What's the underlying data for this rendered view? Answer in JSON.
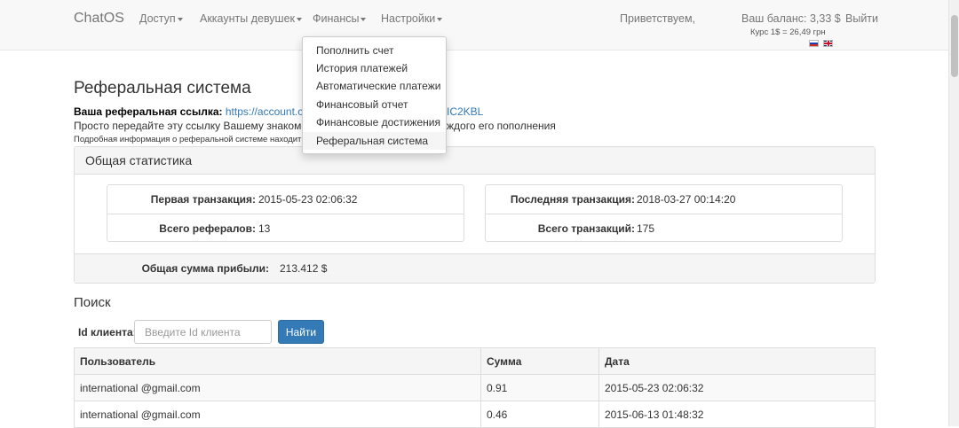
{
  "navbar": {
    "brand": "ChatOS",
    "menu": [
      "Доступ",
      "Аккаунты девушек",
      "Финансы",
      "Настройки"
    ],
    "greeting": "Приветствуем,",
    "balance": "Ваш баланс: 3,33 $",
    "rate": "Курс 1$ = 26,49 грн",
    "logout": "Выйти"
  },
  "finance_menu": {
    "items": [
      "Пополнить счет",
      "История платежей",
      "Автоматические платежи",
      "Финансовый отчет",
      "Финансовые достижения",
      "Реферальная система"
    ],
    "active": "Реферальная система"
  },
  "page": {
    "title": "Реферальная система",
    "ref_label": "Ваша реферальная ссылка:",
    "ref_link_start": "https://account.chato",
    "ref_link_end": "IC2KBL",
    "desc_start": "Просто передайте эту ссылку Вашему знакомому,",
    "desc_end": "ждого его пополнения",
    "more_info": "Подробная информация о реферальной системе находит"
  },
  "stats": {
    "heading": "Общая статистика",
    "left": [
      {
        "label": "Первая транзакция:",
        "value": "2015-05-23 02:06:32"
      },
      {
        "label": "Всего рефералов:",
        "value": "13"
      }
    ],
    "right": [
      {
        "label": "Последняя транзакция:",
        "value": "2018-03-27 00:14:20"
      },
      {
        "label": "Всего транзакций:",
        "value": "175"
      }
    ],
    "total_label": "Общая сумма прибыли:",
    "total_value": "213.412 $"
  },
  "search": {
    "title": "Поиск",
    "client_label": "Id клиента:",
    "placeholder": "Введите Id клиента",
    "button": "Найти"
  },
  "table": {
    "headers": [
      "Пользователь",
      "Сумма",
      "Дата"
    ],
    "rows": [
      [
        "international @gmail.com",
        "0.91",
        "2015-05-23 02:06:32"
      ],
      [
        "international @gmail.com",
        "0.46",
        "2015-06-13 01:48:32"
      ]
    ]
  },
  "colors": {
    "link": "#337ab7",
    "primary_button": "#337ab7",
    "navbar_bg": "#f8f8f8"
  }
}
